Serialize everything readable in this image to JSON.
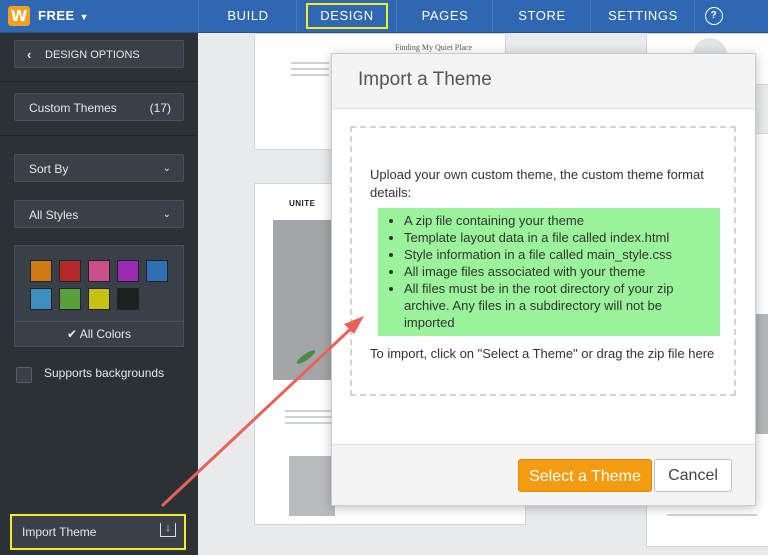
{
  "topbar": {
    "logo": "W",
    "plan_label": "FREE",
    "nav": [
      {
        "label": "BUILD"
      },
      {
        "label": "DESIGN"
      },
      {
        "label": "PAGES"
      },
      {
        "label": "STORE"
      },
      {
        "label": "SETTINGS"
      }
    ],
    "help_glyph": "?"
  },
  "sidebar": {
    "back_label": "DESIGN OPTIONS",
    "custom_themes_label": "Custom Themes",
    "custom_themes_count": "(17)",
    "sort_by_label": "Sort By",
    "styles_label": "All Styles",
    "colors": [
      "#cf7a16",
      "#b42a29",
      "#cc4f8c",
      "#9a2bb4",
      "#2f6fb4",
      "#3e8ec0",
      "#57a03c",
      "#c9c110",
      "#1b2321"
    ],
    "all_colors_label": "All Colors",
    "supports_backgrounds_label": "Supports backgrounds",
    "import_theme_label": "Import Theme"
  },
  "canvas": {
    "card1_title": "Finding My Quiet Place",
    "card2_brand": "UNITE"
  },
  "modal": {
    "title": "Import a Theme",
    "intro": "Upload your own custom theme, the custom theme format details:",
    "requirements": [
      "A zip file containing your theme",
      "Template layout data in a file called index.html",
      "Style information in a file called main_style.css",
      "All image files associated with your theme",
      "All files must be in the root directory of your zip archive. Any files in a subdirectory will not be imported"
    ],
    "instruction": "To import, click on \"Select a Theme\" or drag the zip file here",
    "select_button": "Select a Theme",
    "cancel_button": "Cancel"
  },
  "colors": {
    "topbar": "#2f67b3",
    "highlight": "#f2ec2b",
    "primary_button": "#f39c12",
    "requirements_highlight": "#9af29a",
    "annotation_arrow": "#e8625a"
  }
}
